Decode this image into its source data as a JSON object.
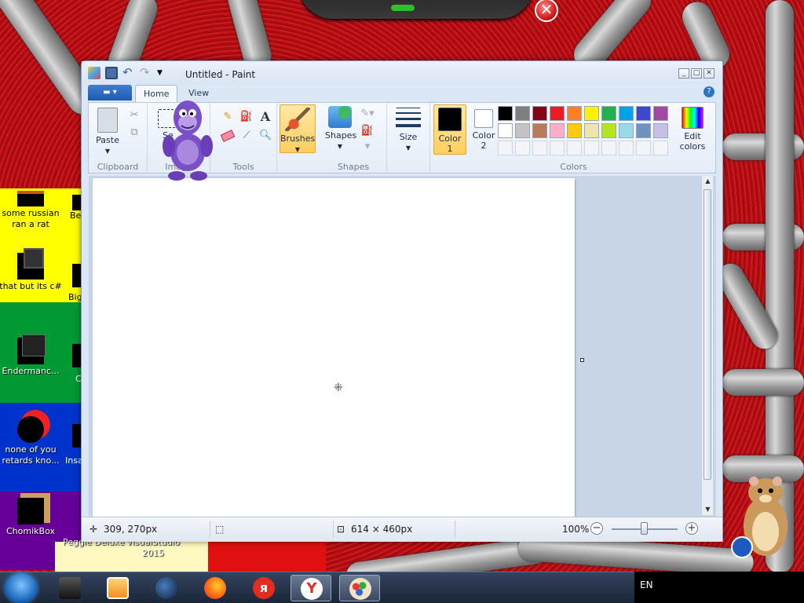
{
  "desktop": {
    "close_glyph": "✕",
    "icons": [
      {
        "label": "some russian ran a rat"
      },
      {
        "label": "that but its c#"
      },
      {
        "label": "Endermanc..."
      },
      {
        "label": "none of you retards kno..."
      },
      {
        "label": "ChomikBox"
      }
    ],
    "partial_icons": [
      {
        "label": "Be"
      },
      {
        "label": "Big"
      },
      {
        "label": "C"
      },
      {
        "label": "Insa"
      },
      {
        "label": "Peggle Deluxe"
      },
      {
        "label": "VisualStudio 2015"
      }
    ]
  },
  "paint": {
    "title": "Untitled - Paint",
    "tabs": {
      "home": "Home",
      "view": "View"
    },
    "help": "?",
    "ribbon": {
      "clipboard": {
        "paste": "Paste",
        "group": "Clipboard"
      },
      "image": {
        "select": "Se",
        "group": "Image"
      },
      "tools": {
        "group": "Tools",
        "text_glyph": "A"
      },
      "brushes": {
        "label": "Brushes"
      },
      "shapes": {
        "label": "Shapes",
        "group": "Shapes"
      },
      "size": {
        "label": "Size"
      },
      "color1": {
        "label": "Color",
        "num": "1"
      },
      "color2": {
        "label": "Color",
        "num": "2"
      },
      "edit_colors": {
        "line1": "Edit",
        "line2": "colors"
      },
      "colors_group": "Colors",
      "palette_row1": [
        "#000000",
        "#7f7f7f",
        "#880015",
        "#ed1c24",
        "#ff7f27",
        "#fff200",
        "#22b14c",
        "#00a2e8",
        "#3f48cc",
        "#a349a4"
      ],
      "palette_row2": [
        "#ffffff",
        "#c3c3c3",
        "#b97a57",
        "#ffaec9",
        "#ffc90e",
        "#efe4b0",
        "#b5e61d",
        "#99d9ea",
        "#7092be",
        "#c8bfe7"
      ],
      "color1_value": "#000000",
      "color2_value": "#ffffff"
    },
    "status": {
      "cursor_pos": "309, 270px",
      "canvas_size": "614 × 460px",
      "zoom": "100%",
      "minus": "−",
      "plus": "+"
    }
  },
  "taskbar": {
    "lang": "EN"
  }
}
